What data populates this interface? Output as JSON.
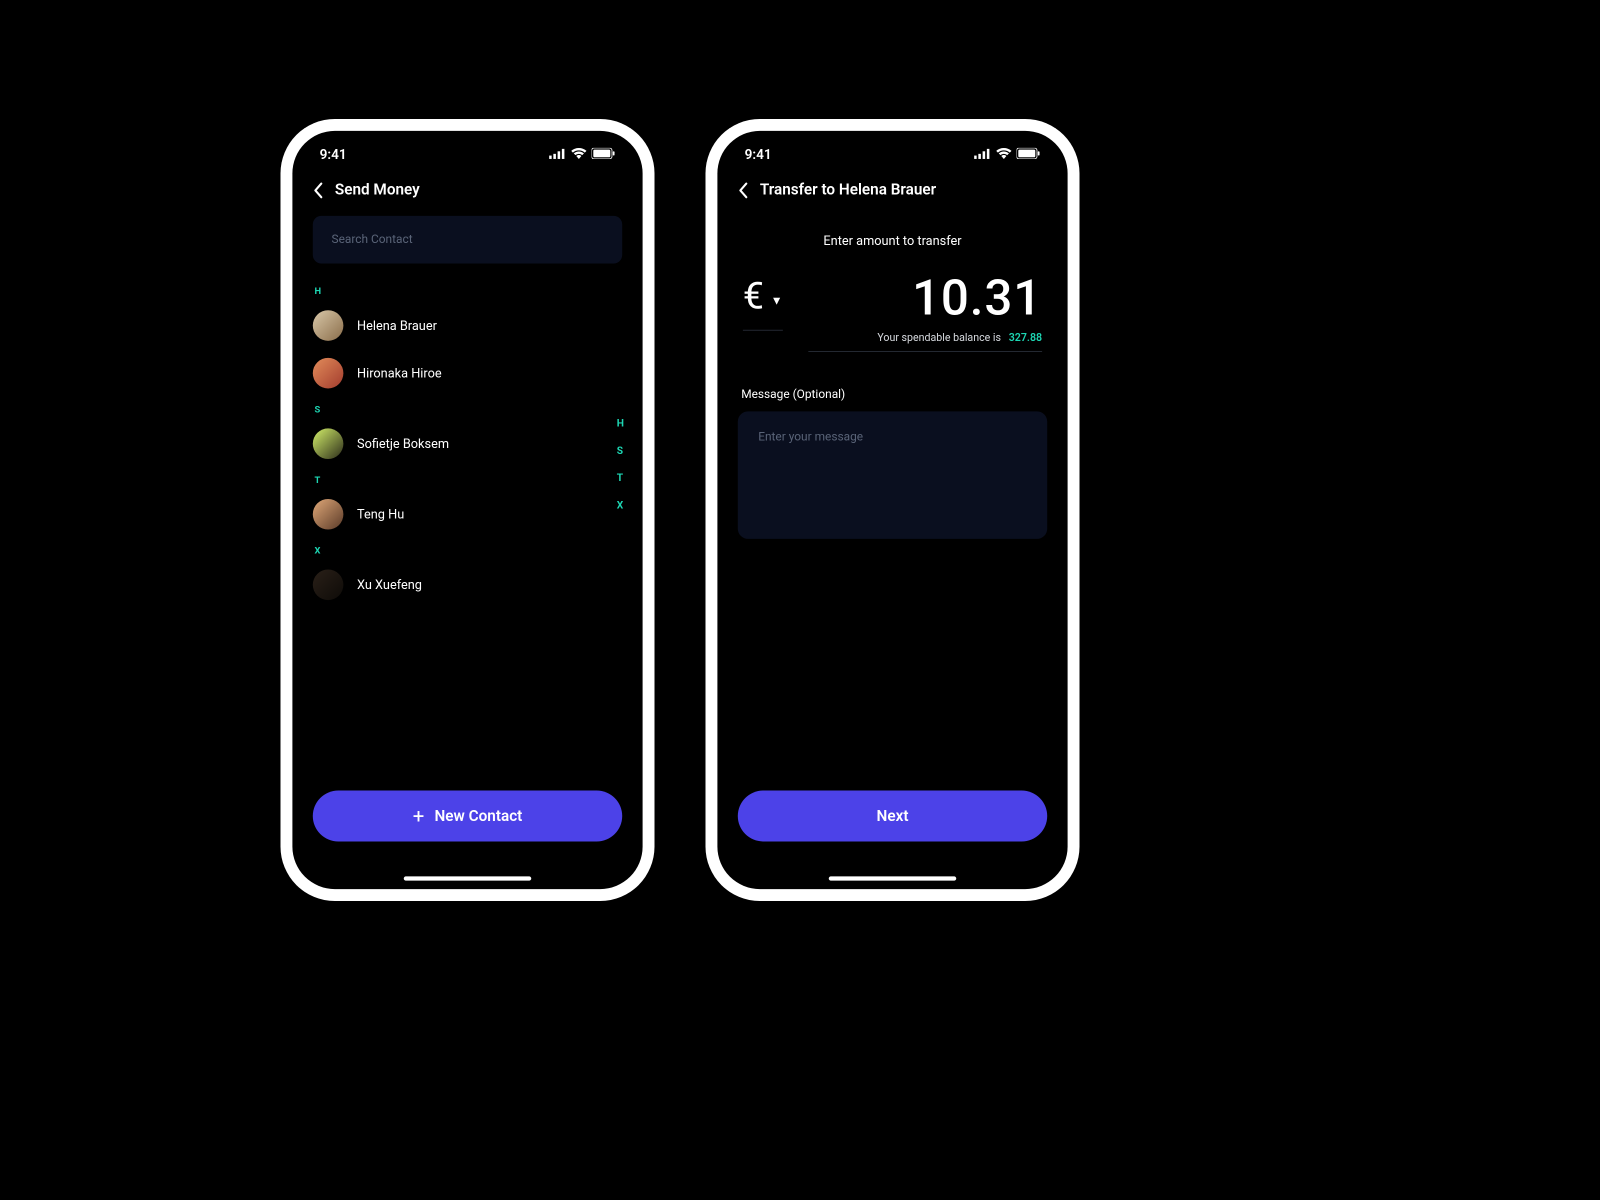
{
  "status": {
    "time": "9:41"
  },
  "colors": {
    "primary": "#4c42e8",
    "accent": "#1dd6b3"
  },
  "screen1": {
    "title": "Send Money",
    "search_placeholder": "Search Contact",
    "sections": [
      {
        "letter": "H",
        "contacts": [
          "Helena Brauer",
          "Hironaka Hiroe"
        ]
      },
      {
        "letter": "S",
        "contacts": [
          "Sofietje Boksem"
        ]
      },
      {
        "letter": "T",
        "contacts": [
          "Teng Hu"
        ]
      },
      {
        "letter": "X",
        "contacts": [
          "Xu Xuefeng"
        ]
      }
    ],
    "index_letters": [
      "H",
      "S",
      "T",
      "X"
    ],
    "new_contact_label": "New Contact"
  },
  "screen2": {
    "title": "Transfer to Helena Brauer",
    "amount_label": "Enter amount to transfer",
    "currency_symbol": "€",
    "amount": "10.31",
    "balance_prefix": "Your spendable balance is",
    "balance_amount": "327.88",
    "message_label": "Message (Optional)",
    "message_placeholder": "Enter your message",
    "next_label": "Next"
  }
}
